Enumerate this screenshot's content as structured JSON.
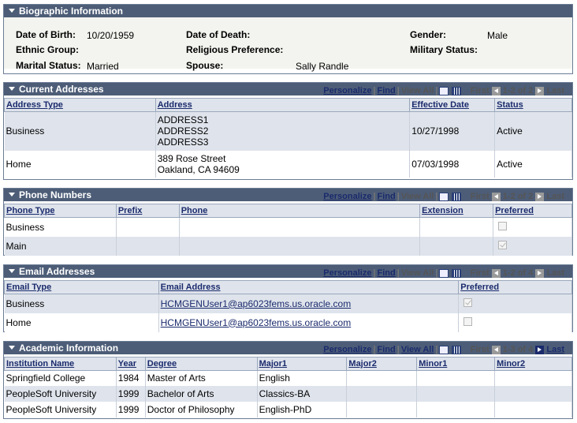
{
  "biographic": {
    "title": "Biographic Information",
    "fields": {
      "dob_label": "Date of Birth:",
      "dob": "10/20/1959",
      "dod_label": "Date of Death:",
      "dod": "",
      "gender_label": "Gender:",
      "gender": "Male",
      "ethnic_label": "Ethnic Group:",
      "ethnic": "",
      "religion_label": "Religious Preference:",
      "religion": "",
      "military_label": "Military Status:",
      "military": "",
      "marital_label": "Marital Status:",
      "marital": "Married",
      "spouse_label": "Spouse:",
      "spouse": "Sally Randle"
    }
  },
  "nav": {
    "personalize": "Personalize",
    "find": "Find",
    "view_all": "View All",
    "first": "First",
    "last": "Last"
  },
  "addresses": {
    "title": "Current Addresses",
    "range": "1-2 of 2",
    "headers": [
      "Address Type",
      "Address",
      "Effective Date",
      "Status"
    ],
    "rows": [
      {
        "type": "Business",
        "address": [
          "ADDRESS1",
          "ADDRESS2",
          "ADDRESS3"
        ],
        "date": "10/27/1998",
        "status": "Active"
      },
      {
        "type": "Home",
        "address": [
          "389 Rose Street",
          "Oakland, CA 94609"
        ],
        "date": "07/03/1998",
        "status": "Active"
      }
    ]
  },
  "phones": {
    "title": "Phone Numbers",
    "range": "1-2 of 2",
    "headers": [
      "Phone Type",
      "Prefix",
      "Phone",
      "Extension",
      "Preferred"
    ],
    "rows": [
      {
        "type": "Business",
        "prefix": "",
        "phone": "",
        "ext": "",
        "preferred": false
      },
      {
        "type": "Main",
        "prefix": "",
        "phone": "",
        "ext": "",
        "preferred": true
      }
    ]
  },
  "emails": {
    "title": "Email Addresses",
    "range": "1-2 of 4",
    "headers": [
      "Email Type",
      "Email Address",
      "Preferred"
    ],
    "rows": [
      {
        "type": "Business",
        "email": "HCMGENUser1@ap6023fems.us.oracle.com",
        "preferred": true
      },
      {
        "type": "Home",
        "email": "HCMGENUser1@ap6023fems.us.oracle.com",
        "preferred": false
      }
    ]
  },
  "academic": {
    "title": "Academic Information",
    "range": "1-3 of 4",
    "headers": [
      "Institution Name",
      "Year",
      "Degree",
      "Major1",
      "Major2",
      "Minor1",
      "Minor2"
    ],
    "rows": [
      {
        "inst": "Springfield College",
        "year": "1984",
        "degree": "Master of Arts",
        "major1": "English"
      },
      {
        "inst": "PeopleSoft University",
        "year": "1999",
        "degree": "Bachelor of Arts",
        "major1": "Classics-BA"
      },
      {
        "inst": "PeopleSoft University",
        "year": "1999",
        "degree": "Doctor of Philosophy",
        "major1": "English-PhD"
      }
    ]
  }
}
